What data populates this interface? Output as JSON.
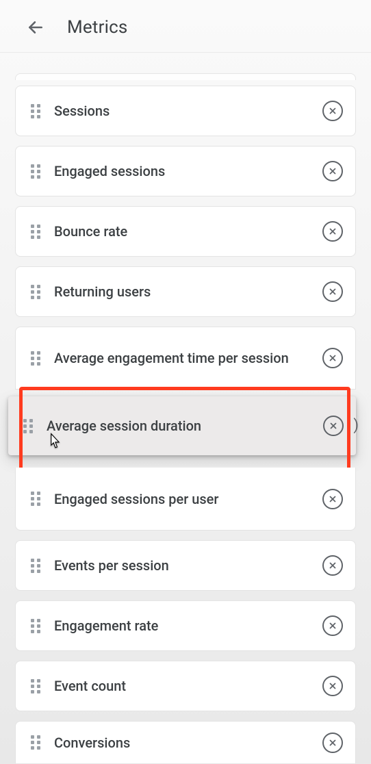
{
  "header": {
    "title": "Metrics"
  },
  "metrics": [
    {
      "label": "Sessions"
    },
    {
      "label": "Engaged sessions"
    },
    {
      "label": "Bounce rate"
    },
    {
      "label": "Returning users"
    },
    {
      "label": "Average engagement time per session"
    },
    {
      "label": "Average session duration"
    },
    {
      "label": "Engaged sessions per user"
    },
    {
      "label": "Events per session"
    },
    {
      "label": "Engagement rate"
    },
    {
      "label": "Event count"
    },
    {
      "label": "Conversions"
    }
  ],
  "highlight": {
    "color": "#ff3b1f"
  }
}
